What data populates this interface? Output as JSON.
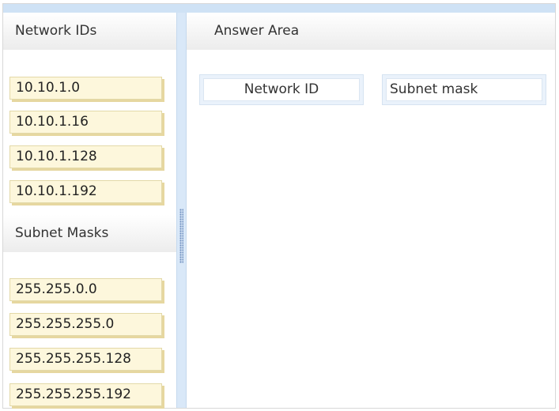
{
  "left_panel": {
    "network_ids_title": "Network IDs",
    "network_ids": [
      "10.10.1.0",
      "10.10.1.16",
      "10.10.1.128",
      "10.10.1.192"
    ],
    "subnet_masks_title": "Subnet Masks",
    "subnet_masks": [
      "255.255.0.0",
      "255.255.255.0",
      "255.255.255.128",
      "255.255.255.192"
    ]
  },
  "answer_area": {
    "title": "Answer Area",
    "columns": [
      "Network ID",
      "Subnet mask"
    ]
  },
  "colors": {
    "item_background": "#fdf7dc",
    "item_shadow": "#e6d7a0",
    "splitter": "#d9e8f8",
    "answer_box": "#eaf2fb"
  }
}
